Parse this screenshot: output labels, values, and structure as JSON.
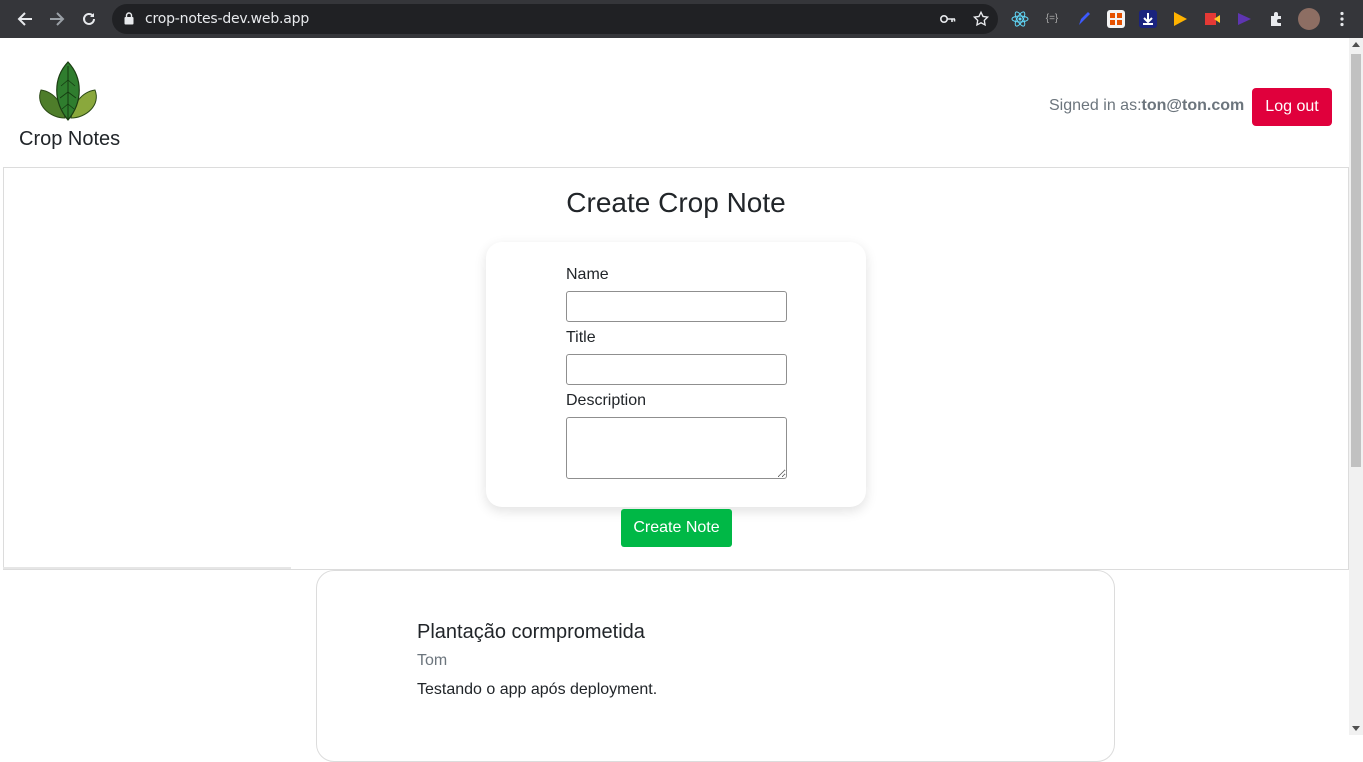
{
  "browser": {
    "url": "crop-notes-dev.web.app"
  },
  "header": {
    "brand": "Crop Notes",
    "signed_in_label": "Signed in as:",
    "signed_in_user": "ton@ton.com",
    "logout_label": "Log out"
  },
  "create": {
    "title": "Create Crop Note",
    "name_label": "Name",
    "name_value": "",
    "title_label": "Title",
    "title_value": "",
    "description_label": "Description",
    "description_value": "",
    "submit_label": "Create Note"
  },
  "notes": [
    {
      "title": "Plantação cormprometida",
      "author": "Tom",
      "description": "Testando o app após deployment."
    }
  ],
  "colors": {
    "logout": "#e0003c",
    "create_button": "#00b846",
    "chrome_bg": "#35363a"
  },
  "icons": [
    "back-arrow-icon",
    "forward-arrow-icon",
    "reload-icon",
    "lock-icon",
    "key-icon",
    "star-icon",
    "extensions-icon",
    "menu-icon",
    "leaf-logo"
  ]
}
